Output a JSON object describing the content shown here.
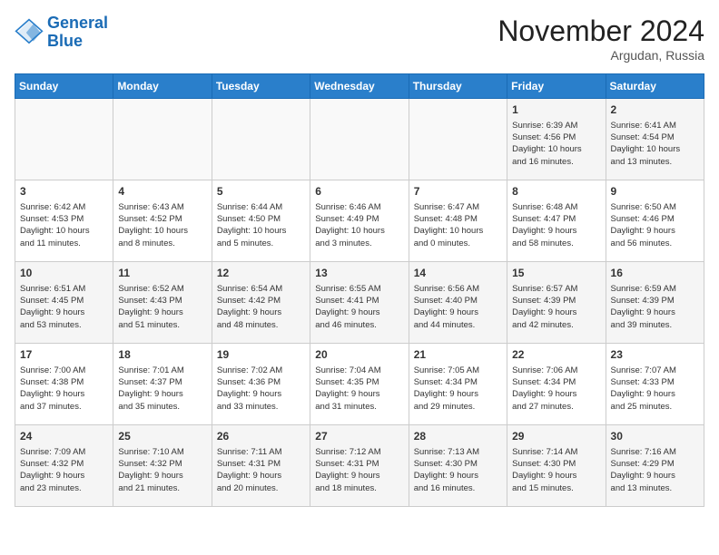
{
  "header": {
    "logo_line1": "General",
    "logo_line2": "Blue",
    "month": "November 2024",
    "location": "Argudan, Russia"
  },
  "weekdays": [
    "Sunday",
    "Monday",
    "Tuesday",
    "Wednesday",
    "Thursday",
    "Friday",
    "Saturday"
  ],
  "weeks": [
    [
      {
        "day": "",
        "info": ""
      },
      {
        "day": "",
        "info": ""
      },
      {
        "day": "",
        "info": ""
      },
      {
        "day": "",
        "info": ""
      },
      {
        "day": "",
        "info": ""
      },
      {
        "day": "1",
        "info": "Sunrise: 6:39 AM\nSunset: 4:56 PM\nDaylight: 10 hours\nand 16 minutes."
      },
      {
        "day": "2",
        "info": "Sunrise: 6:41 AM\nSunset: 4:54 PM\nDaylight: 10 hours\nand 13 minutes."
      }
    ],
    [
      {
        "day": "3",
        "info": "Sunrise: 6:42 AM\nSunset: 4:53 PM\nDaylight: 10 hours\nand 11 minutes."
      },
      {
        "day": "4",
        "info": "Sunrise: 6:43 AM\nSunset: 4:52 PM\nDaylight: 10 hours\nand 8 minutes."
      },
      {
        "day": "5",
        "info": "Sunrise: 6:44 AM\nSunset: 4:50 PM\nDaylight: 10 hours\nand 5 minutes."
      },
      {
        "day": "6",
        "info": "Sunrise: 6:46 AM\nSunset: 4:49 PM\nDaylight: 10 hours\nand 3 minutes."
      },
      {
        "day": "7",
        "info": "Sunrise: 6:47 AM\nSunset: 4:48 PM\nDaylight: 10 hours\nand 0 minutes."
      },
      {
        "day": "8",
        "info": "Sunrise: 6:48 AM\nSunset: 4:47 PM\nDaylight: 9 hours\nand 58 minutes."
      },
      {
        "day": "9",
        "info": "Sunrise: 6:50 AM\nSunset: 4:46 PM\nDaylight: 9 hours\nand 56 minutes."
      }
    ],
    [
      {
        "day": "10",
        "info": "Sunrise: 6:51 AM\nSunset: 4:45 PM\nDaylight: 9 hours\nand 53 minutes."
      },
      {
        "day": "11",
        "info": "Sunrise: 6:52 AM\nSunset: 4:43 PM\nDaylight: 9 hours\nand 51 minutes."
      },
      {
        "day": "12",
        "info": "Sunrise: 6:54 AM\nSunset: 4:42 PM\nDaylight: 9 hours\nand 48 minutes."
      },
      {
        "day": "13",
        "info": "Sunrise: 6:55 AM\nSunset: 4:41 PM\nDaylight: 9 hours\nand 46 minutes."
      },
      {
        "day": "14",
        "info": "Sunrise: 6:56 AM\nSunset: 4:40 PM\nDaylight: 9 hours\nand 44 minutes."
      },
      {
        "day": "15",
        "info": "Sunrise: 6:57 AM\nSunset: 4:39 PM\nDaylight: 9 hours\nand 42 minutes."
      },
      {
        "day": "16",
        "info": "Sunrise: 6:59 AM\nSunset: 4:39 PM\nDaylight: 9 hours\nand 39 minutes."
      }
    ],
    [
      {
        "day": "17",
        "info": "Sunrise: 7:00 AM\nSunset: 4:38 PM\nDaylight: 9 hours\nand 37 minutes."
      },
      {
        "day": "18",
        "info": "Sunrise: 7:01 AM\nSunset: 4:37 PM\nDaylight: 9 hours\nand 35 minutes."
      },
      {
        "day": "19",
        "info": "Sunrise: 7:02 AM\nSunset: 4:36 PM\nDaylight: 9 hours\nand 33 minutes."
      },
      {
        "day": "20",
        "info": "Sunrise: 7:04 AM\nSunset: 4:35 PM\nDaylight: 9 hours\nand 31 minutes."
      },
      {
        "day": "21",
        "info": "Sunrise: 7:05 AM\nSunset: 4:34 PM\nDaylight: 9 hours\nand 29 minutes."
      },
      {
        "day": "22",
        "info": "Sunrise: 7:06 AM\nSunset: 4:34 PM\nDaylight: 9 hours\nand 27 minutes."
      },
      {
        "day": "23",
        "info": "Sunrise: 7:07 AM\nSunset: 4:33 PM\nDaylight: 9 hours\nand 25 minutes."
      }
    ],
    [
      {
        "day": "24",
        "info": "Sunrise: 7:09 AM\nSunset: 4:32 PM\nDaylight: 9 hours\nand 23 minutes."
      },
      {
        "day": "25",
        "info": "Sunrise: 7:10 AM\nSunset: 4:32 PM\nDaylight: 9 hours\nand 21 minutes."
      },
      {
        "day": "26",
        "info": "Sunrise: 7:11 AM\nSunset: 4:31 PM\nDaylight: 9 hours\nand 20 minutes."
      },
      {
        "day": "27",
        "info": "Sunrise: 7:12 AM\nSunset: 4:31 PM\nDaylight: 9 hours\nand 18 minutes."
      },
      {
        "day": "28",
        "info": "Sunrise: 7:13 AM\nSunset: 4:30 PM\nDaylight: 9 hours\nand 16 minutes."
      },
      {
        "day": "29",
        "info": "Sunrise: 7:14 AM\nSunset: 4:30 PM\nDaylight: 9 hours\nand 15 minutes."
      },
      {
        "day": "30",
        "info": "Sunrise: 7:16 AM\nSunset: 4:29 PM\nDaylight: 9 hours\nand 13 minutes."
      }
    ]
  ]
}
